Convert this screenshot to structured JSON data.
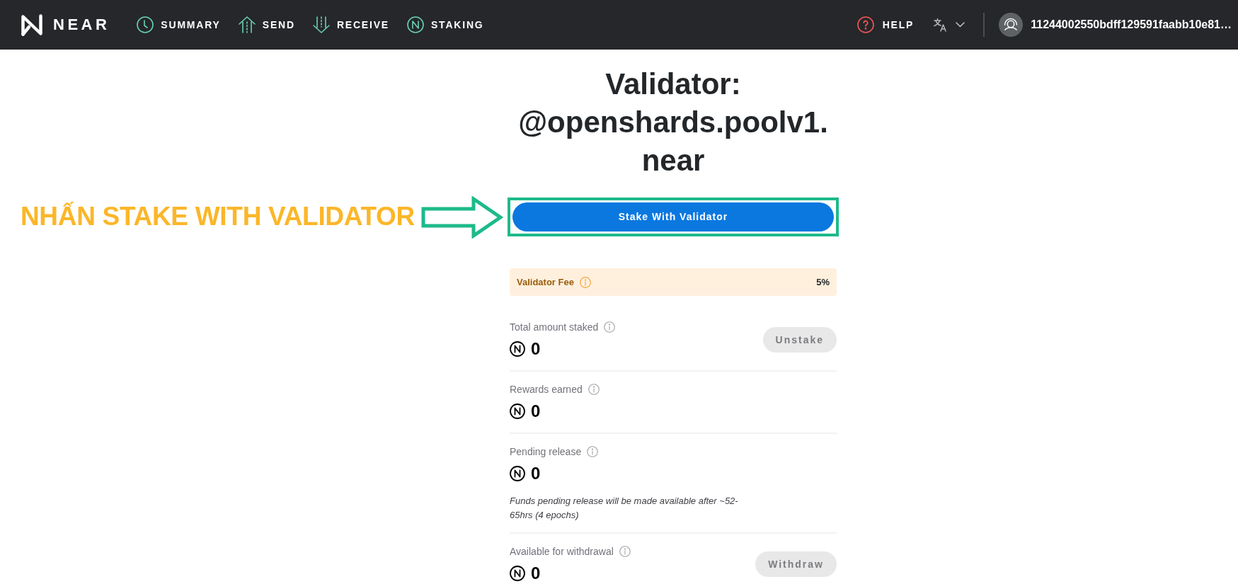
{
  "navbar": {
    "logo": "NEAR",
    "nav_items": [
      {
        "label": "SUMMARY"
      },
      {
        "label": "SEND"
      },
      {
        "label": "RECEIVE"
      },
      {
        "label": "STAKING"
      }
    ],
    "help": "HELP",
    "account": "11244002550bdff129591faabb10e81…"
  },
  "annotation": {
    "text": "NHẤN STAKE WITH VALIDATOR"
  },
  "validator": {
    "title_lines": [
      "Validator:",
      "@openshards.poolv1.",
      "near"
    ],
    "stake_button": {
      "label": "Stake With Validator"
    },
    "fee": {
      "label": "Validator Fee",
      "value": "5%"
    },
    "balances": [
      {
        "label": "Total amount staked",
        "amount": "0",
        "button": {
          "label": "Unstake",
          "disabled": true
        }
      },
      {
        "label": "Rewards earned",
        "amount": "0"
      },
      {
        "label": "Pending release",
        "amount": "0",
        "note": "Funds pending release will be made available after ~52-65hrs (4 epochs)"
      },
      {
        "label": "Available for withdrawal",
        "amount": "0",
        "button": {
          "label": "Withdraw",
          "disabled": true
        }
      }
    ]
  }
}
